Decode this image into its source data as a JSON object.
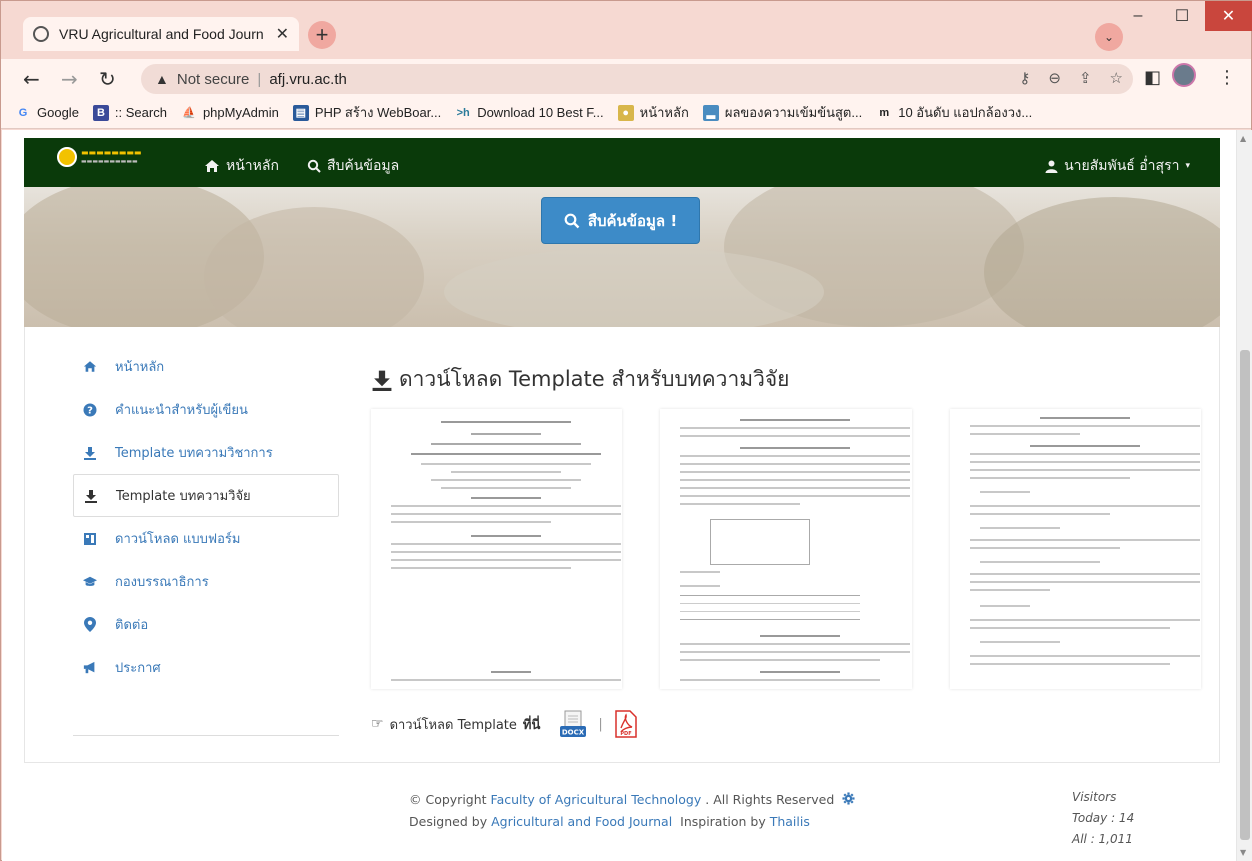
{
  "browser": {
    "tab_title": "VRU Agricultural and Food Journ",
    "url_prefix": "Not secure",
    "url": "afj.vru.ac.th",
    "bookmarks": [
      {
        "label": "Google"
      },
      {
        "label": ":: Search"
      },
      {
        "label": "phpMyAdmin"
      },
      {
        "label": "PHP สร้าง WebBoar..."
      },
      {
        "label": "Download 10 Best F..."
      },
      {
        "label": "หน้าหลัก"
      },
      {
        "label": "ผลของความเข้มข้นสูต..."
      },
      {
        "label": "10 อันดับ แอปกล้องวง..."
      }
    ]
  },
  "site": {
    "nav": {
      "home": "หน้าหลัก",
      "search": "สืบค้นข้อมูล",
      "user": "นายสัมพันธ์ อ่ำสุรา"
    },
    "hero_button": "สืบค้นข้อมูล !",
    "sidebar": [
      {
        "label": "หน้าหลัก"
      },
      {
        "label": "คำแนะนำสำหรับผู้เขียน"
      },
      {
        "label": "Template บทความวิชาการ"
      },
      {
        "label": "Template บทความวิจัย"
      },
      {
        "label": "ดาวน์โหลด แบบฟอร์ม"
      },
      {
        "label": "กองบรรณาธิการ"
      },
      {
        "label": "ติดต่อ"
      },
      {
        "label": "ประกาศ"
      }
    ],
    "content": {
      "title": "ดาวน์โหลด Template สำหรับบทความวิจัย",
      "download_text": "ดาวน์โหลด Template",
      "download_text_bold": "ที่นี่",
      "docx_label": "DOCX",
      "pdf_label": "PDF"
    },
    "footer": {
      "copyright_pre": "© Copyright",
      "copyright_org": "Faculty of Agricultural Technology",
      "copyright_post": ". All Rights Reserved",
      "designed_pre": "Designed by",
      "designed_org": "Agricultural and Food Journal",
      "inspiration_pre": "Inspiration by",
      "inspiration_org": "Thailis",
      "visitors_title": "Visitors",
      "today": "Today : 14",
      "all": "All : 1,011"
    }
  }
}
